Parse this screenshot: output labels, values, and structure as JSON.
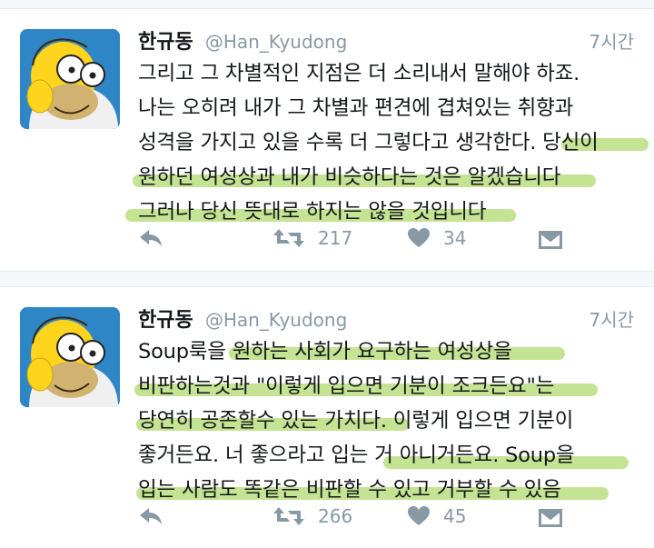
{
  "tweets": [
    {
      "name": "한규동",
      "handle": "@Han_Kyudong",
      "time": "7시간",
      "lines": [
        "그리고 그 차별적인 지점은 더 소리내서 말해야 하죠.",
        "나는 오히려 내가 그 차별과 편견에 겹쳐있는 취향과",
        "성격을 가지고 있을 수록 더 그렇다고 생각한다. 당신이",
        "원하던 여성상과 내가 비슷하다는 것은 알겠습니다",
        "그러나 당신 뜻대로 하지는 않을 것입니다"
      ],
      "retweets": "217",
      "likes": "34"
    },
    {
      "name": "한규동",
      "handle": "@Han_Kyudong",
      "time": "7시간",
      "lines": [
        "Soup룩을 원하는 사회가 요구하는 여성상을",
        "비판하는것과 \"이렇게 입으면 기분이 조크든요\"는",
        "당연히 공존할수 있는 가치다. 이렇게 입으면 기분이",
        "좋거든요. 너 좋으라고 입는 거 아니거든요. Soup을",
        "입는 사람도 똑같은 비판할 수 있고 거부할 수 있음"
      ],
      "retweets": "266",
      "likes": "45"
    }
  ],
  "icons": {
    "reply": "reply-icon",
    "retweet": "retweet-icon",
    "like": "heart-icon",
    "message": "envelope-icon"
  },
  "colors": {
    "highlighter": "#a0d250",
    "muted": "#8899a6",
    "text": "#14171a"
  }
}
